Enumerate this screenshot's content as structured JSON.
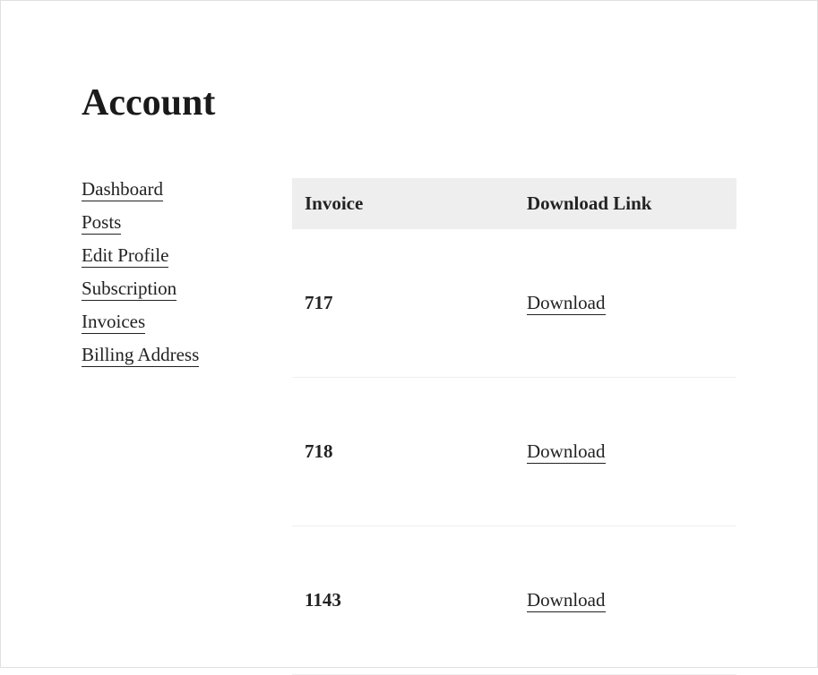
{
  "page": {
    "title": "Account"
  },
  "sidebar": {
    "items": [
      {
        "label": "Dashboard"
      },
      {
        "label": "Posts"
      },
      {
        "label": "Edit Profile"
      },
      {
        "label": "Subscription"
      },
      {
        "label": "Invoices"
      },
      {
        "label": "Billing Address"
      }
    ]
  },
  "table": {
    "headers": {
      "invoice": "Invoice",
      "download": "Download Link"
    },
    "rows": [
      {
        "invoice": "717",
        "download": "Download"
      },
      {
        "invoice": "718",
        "download": "Download"
      },
      {
        "invoice": "1143",
        "download": "Download"
      }
    ]
  }
}
